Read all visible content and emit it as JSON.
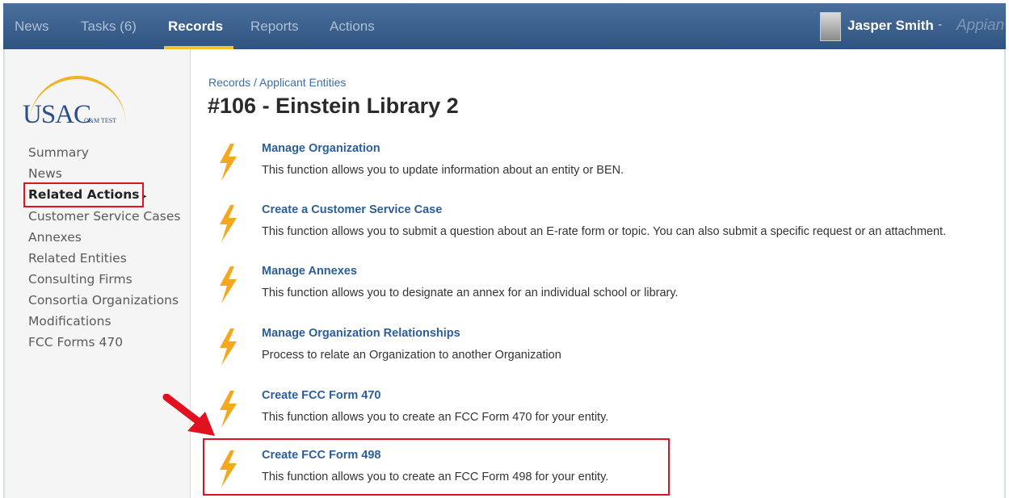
{
  "nav": {
    "items": [
      {
        "label": "News"
      },
      {
        "label": "Tasks (6)"
      },
      {
        "label": "Records"
      },
      {
        "label": "Reports"
      },
      {
        "label": "Actions"
      }
    ],
    "active": "Records",
    "user_name": "Jasper Smith",
    "user_caret": "-",
    "brand": "Appian"
  },
  "logo": {
    "text": "USAC",
    "subtext": "O&M TEST"
  },
  "sidebar": {
    "items": [
      {
        "label": "Summary"
      },
      {
        "label": "News"
      },
      {
        "label": "Related Actions"
      },
      {
        "label": "Customer Service Cases"
      },
      {
        "label": "Annexes"
      },
      {
        "label": "Related Entities"
      },
      {
        "label": "Consulting Firms"
      },
      {
        "label": "Consortia Organizations"
      },
      {
        "label": "Modifications"
      },
      {
        "label": "FCC Forms 470"
      }
    ],
    "active": "Related Actions",
    "active_caret": "▸"
  },
  "breadcrumb": "Records / Applicant Entities",
  "page_title": "#106 - Einstein Library 2",
  "actions": [
    {
      "title": "Manage Organization",
      "description": "This function allows you to update information about an entity or BEN."
    },
    {
      "title": "Create a Customer Service Case",
      "description": "This function allows you to submit a question about an E-rate form or topic. You can also submit a specific request or an attachment."
    },
    {
      "title": "Manage Annexes",
      "description": "This function allows you to designate an annex for an individual school or library."
    },
    {
      "title": "Manage Organization Relationships",
      "description": "Process to relate an Organization to another Organization"
    },
    {
      "title": "Create FCC Form 470",
      "description": "This function allows you to create an FCC Form 470 for your entity."
    },
    {
      "title": "Create FCC Form 498",
      "description": "This function allows you to create an FCC Form 498 for your entity."
    }
  ],
  "colors": {
    "nav_bg": "#3c5f8a",
    "nav_active_underline": "#f1c232",
    "link_blue": "#2b5e9a",
    "bolt_orange": "#f5a81c",
    "highlight_red": "#e0121f"
  }
}
